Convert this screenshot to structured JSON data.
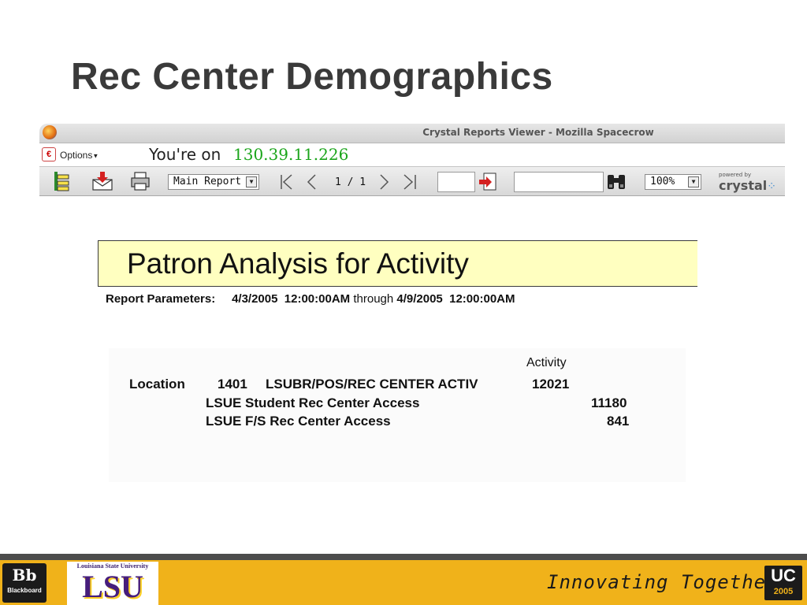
{
  "slide": {
    "title": "Rec Center Demographics"
  },
  "browser": {
    "window_title": "Crystal Reports Viewer - Mozilla Spacecrow",
    "options_label": "Options",
    "you_are_on_label": "You're on",
    "ip_address": "130.39.11.226"
  },
  "toolbar": {
    "report_select_value": "Main Report",
    "page_indicator": "1 / 1",
    "goto_page_value": "",
    "search_value": "",
    "zoom_value": "100%",
    "brand_small": "powered by",
    "brand_big": "crystal"
  },
  "report": {
    "title": "Patron Analysis for Activity",
    "params_label": "Report Parameters:",
    "params_from": "4/3/2005  12:00:00AM",
    "params_through": "through",
    "params_to": "4/9/2005  12:00:00AM",
    "column_header": "Activity",
    "location_label": "Location",
    "location_code": "1401",
    "location_name": "LSUBR/POS/REC CENTER ACTIV",
    "location_total": "12021",
    "rows": [
      {
        "name": "LSUE Student Rec Center Access",
        "value": "11180"
      },
      {
        "name": "LSUE F/S Rec Center Access",
        "value": "841"
      }
    ]
  },
  "footer": {
    "bb_mark": "Bb",
    "bb_text": "Blackboard",
    "lsu_small": "Louisiana State University",
    "lsu_big": "LSU",
    "tagline": "Innovating Together.",
    "uc_mark": "UC",
    "uc_year": "2005"
  },
  "colors": {
    "report_banner": "#ffffc0",
    "footer_bar": "#f0b21a",
    "ip_text": "#1aa51a"
  },
  "icons": [
    "browser-app-icon",
    "options-menu-icon",
    "group-tree-icon",
    "export-icon",
    "print-icon",
    "first-page-icon",
    "previous-page-icon",
    "next-page-icon",
    "last-page-icon",
    "go-to-page-icon",
    "search-binoculars-icon",
    "crystal-logo-icon"
  ]
}
